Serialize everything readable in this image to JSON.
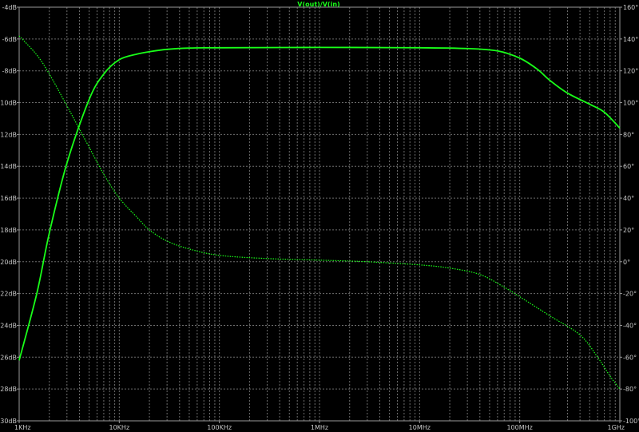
{
  "chart_data": {
    "type": "line",
    "title": "V(out)/V(in)",
    "xscale": "log",
    "xlim": [
      1000,
      1000000000
    ],
    "x_ticks": [
      {
        "value": 1000,
        "label": "1KHz"
      },
      {
        "value": 10000,
        "label": "10KHz"
      },
      {
        "value": 100000,
        "label": "100KHz"
      },
      {
        "value": 1000000,
        "label": "1MHz"
      },
      {
        "value": 10000000,
        "label": "10MHz"
      },
      {
        "value": 100000000,
        "label": "100MHz"
      },
      {
        "value": 1000000000,
        "label": "1GHz"
      }
    ],
    "ylim_left": [
      -30,
      -4
    ],
    "left_ticks": [
      {
        "value": -4,
        "label": "-4dB"
      },
      {
        "value": -6,
        "label": "-6dB"
      },
      {
        "value": -8,
        "label": "-8dB"
      },
      {
        "value": -10,
        "label": "-10dB"
      },
      {
        "value": -12,
        "label": "-12dB"
      },
      {
        "value": -14,
        "label": "-14dB"
      },
      {
        "value": -16,
        "label": "-16dB"
      },
      {
        "value": -18,
        "label": "-18dB"
      },
      {
        "value": -20,
        "label": "-20dB"
      },
      {
        "value": -22,
        "label": "-22dB"
      },
      {
        "value": -24,
        "label": "-24dB"
      },
      {
        "value": -26,
        "label": "-26dB"
      },
      {
        "value": -28,
        "label": "-28dB"
      },
      {
        "value": -30,
        "label": "-30dB"
      }
    ],
    "ylim_right": [
      -100,
      160
    ],
    "right_ticks": [
      {
        "value": 160,
        "label": "160°"
      },
      {
        "value": 140,
        "label": "140°"
      },
      {
        "value": 120,
        "label": "120°"
      },
      {
        "value": 100,
        "label": "100°"
      },
      {
        "value": 80,
        "label": "80°"
      },
      {
        "value": 60,
        "label": "60°"
      },
      {
        "value": 40,
        "label": "40°"
      },
      {
        "value": 20,
        "label": "20°"
      },
      {
        "value": 0,
        "label": "0°"
      },
      {
        "value": -20,
        "label": "-20°"
      },
      {
        "value": -40,
        "label": "-40°"
      },
      {
        "value": -60,
        "label": "-60°"
      },
      {
        "value": -80,
        "label": "-80°"
      },
      {
        "value": -100,
        "label": "-100°"
      }
    ],
    "grid": true,
    "colors": {
      "background": "#000000",
      "grid": "#6e6e6e",
      "frame": "#9a9a9a",
      "trace": "#19ff19",
      "tick_text": "#c8c8c8"
    },
    "series": [
      {
        "axis": "left",
        "style": "solid",
        "x": [
          1000,
          1500,
          2000,
          3000,
          5000,
          7000,
          10000,
          15000,
          20000,
          30000,
          50000,
          100000,
          1000000,
          10000000,
          30000000,
          60000000,
          100000000,
          150000000,
          200000000,
          300000000,
          500000000,
          700000000,
          1000000000
        ],
        "y": [
          -26.2,
          -22.0,
          -18.2,
          -13.8,
          -9.8,
          -8.2,
          -7.3,
          -6.95,
          -6.8,
          -6.65,
          -6.57,
          -6.55,
          -6.53,
          -6.55,
          -6.6,
          -6.75,
          -7.2,
          -7.9,
          -8.6,
          -9.4,
          -10.1,
          -10.6,
          -11.6
        ]
      },
      {
        "axis": "right",
        "style": "dotted",
        "x": [
          1000,
          1500,
          2000,
          3000,
          5000,
          7000,
          10000,
          15000,
          20000,
          30000,
          50000,
          100000,
          300000,
          1000000,
          3000000,
          10000000,
          20000000,
          40000000,
          70000000,
          100000000,
          200000000,
          400000000,
          600000000,
          800000000,
          1000000000
        ],
        "y": [
          142,
          130,
          118,
          98,
          72,
          55,
          40,
          28,
          20,
          13,
          8,
          4,
          2,
          1,
          0,
          -2,
          -4,
          -8,
          -16,
          -22,
          -34,
          -46,
          -60,
          -72,
          -80
        ]
      }
    ]
  }
}
